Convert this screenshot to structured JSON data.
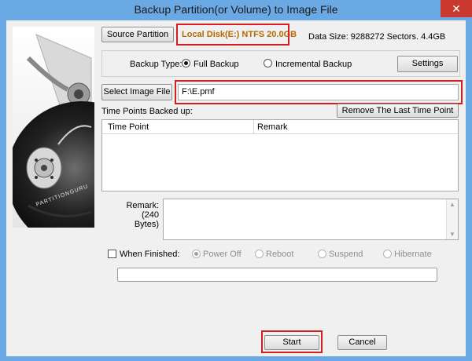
{
  "window": {
    "title": "Backup Partition(or Volume) to Image File",
    "close_glyph": "✕"
  },
  "source": {
    "button_label": "Source Partition",
    "value": "Local Disk(E:) NTFS 20.0GB",
    "data_size": "Data Size: 9288272 Sectors. 4.4GB"
  },
  "backup_type": {
    "label": "Backup Type:",
    "full": "Full Backup",
    "incremental": "Incremental Backup",
    "selected": "full",
    "settings_label": "Settings"
  },
  "image_file": {
    "button_label": "Select Image File",
    "value": "F:\\E.pmf"
  },
  "time_points": {
    "label": "Time Points Backed up:",
    "remove_label": "Remove The Last Time Point",
    "columns": [
      "Time Point",
      "Remark"
    ],
    "rows": []
  },
  "remark": {
    "label": "Remark:",
    "hint": "(240 Bytes)",
    "value": ""
  },
  "when_finished": {
    "label": "When Finished:",
    "options": [
      "Power Off",
      "Reboot",
      "Suspend",
      "Hibernate"
    ],
    "selected": "Power Off",
    "enabled": false
  },
  "actions": {
    "start": "Start",
    "cancel": "Cancel"
  },
  "image": {
    "brand_text": "PARTITIONGURU"
  },
  "colors": {
    "title_bar": "#6aa9e4",
    "highlight_border": "#d31f1f",
    "disk_text": "#b36b00",
    "close": "#c9382e"
  }
}
